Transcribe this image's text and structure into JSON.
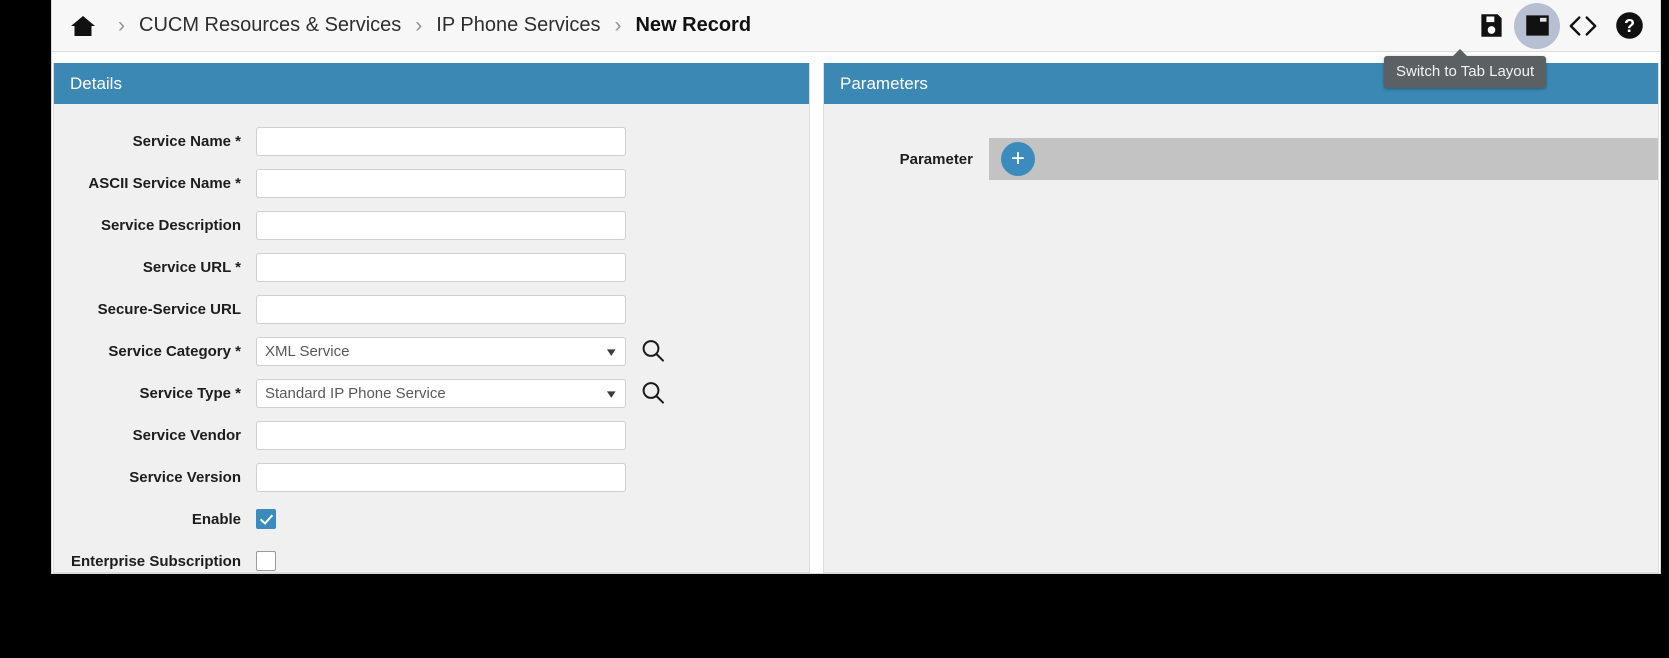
{
  "breadcrumb": {
    "home_icon": "home-icon",
    "separator": "›",
    "items": [
      {
        "label": "CUCM Resources & Services",
        "current": false
      },
      {
        "label": "IP Phone Services",
        "current": false
      },
      {
        "label": "New Record",
        "current": true
      }
    ]
  },
  "toolbar": {
    "save_icon": "save-floppy-icon",
    "layout_icon": "tab-layout-icon",
    "code_icon": "code-brackets-icon",
    "help_icon": "help-question-icon",
    "tooltip": "Switch to Tab Layout"
  },
  "colors": {
    "panel_header": "#3b88b5",
    "accent": "#3b8cbd",
    "panel_body": "#f0f0f0",
    "strip": "#c3c3c3",
    "tooltip_bg": "#5b6063"
  },
  "details": {
    "title": "Details",
    "fields": [
      {
        "label": "Service Name *",
        "type": "text",
        "value": "",
        "placeholder": ""
      },
      {
        "label": "ASCII Service Name *",
        "type": "text",
        "value": "",
        "placeholder": ""
      },
      {
        "label": "Service Description",
        "type": "text",
        "value": "",
        "placeholder": ""
      },
      {
        "label": "Service URL *",
        "type": "text",
        "value": "",
        "placeholder": ""
      },
      {
        "label": "Secure-Service URL",
        "type": "text",
        "value": "",
        "placeholder": ""
      },
      {
        "label": "Service Category *",
        "type": "select",
        "value": "XML Service",
        "lookup": true
      },
      {
        "label": "Service Type *",
        "type": "select",
        "value": "Standard IP Phone Service",
        "lookup": true
      },
      {
        "label": "Service Vendor",
        "type": "text",
        "value": "",
        "placeholder": ""
      },
      {
        "label": "Service Version",
        "type": "text",
        "value": "",
        "placeholder": ""
      },
      {
        "label": "Enable",
        "type": "checkbox",
        "checked": true
      },
      {
        "label": "Enterprise Subscription",
        "type": "checkbox",
        "checked": false
      }
    ]
  },
  "parameters": {
    "title": "Parameters",
    "row_label": "Parameter",
    "add_label": "+"
  }
}
